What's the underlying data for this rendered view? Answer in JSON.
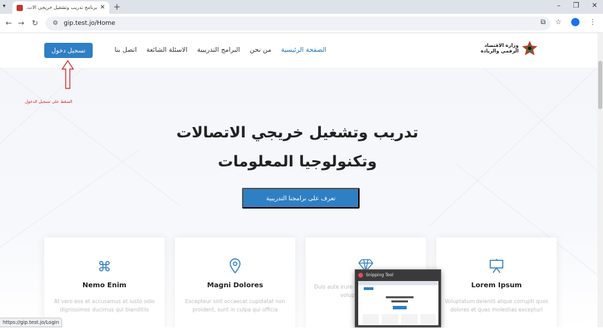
{
  "browser": {
    "tab_title": "برنامج تدريب وتشغيل خريجي الات...",
    "url": "gip.test.jo/Home",
    "status_url": "https://gip.test.jo/Login"
  },
  "site": {
    "logo_line1": "وزارة الاقتصاد",
    "logo_line2": "الرقمي والريادة",
    "nav": [
      "الصفحة الرئيسية",
      "من نحن",
      "البرامج التدريبية",
      "الاسئلة الشائعة",
      "اتصل بنا"
    ],
    "login_label": "تسجيل دخول",
    "annotation": "الضغط على تسجيل الدخول",
    "hero_title": "تدريب وتشغيل خريجي الاتصالات وتكنولوجيا المعلومات",
    "cta_label": "تعرف على برامجنا التدريبية",
    "cards": [
      {
        "icon": "command-icon",
        "title": "Nemo Enim",
        "desc": "At vero eos et accusamus et iusto odio dignissimos ducimus qui blanditiis"
      },
      {
        "icon": "location-pin-icon",
        "title": "Magni Dolores",
        "desc": "Excepteur sint occaecat cupidatat non proident, sunt in culpa qui officia"
      },
      {
        "icon": "diamond-icon",
        "title": "",
        "desc": "Duis aute irure dolor in reprehenderit in voluptate velit esse"
      },
      {
        "icon": "easel-icon",
        "title": "Lorem Ipsum",
        "desc": "Voluptatum deleniti atque corrupti quos dolores et quas molestias excepturi"
      }
    ]
  },
  "snipping_tool": {
    "title": "Snipping Tool"
  },
  "colors": {
    "primary": "#2f7fc4",
    "annotation": "#d21f1f"
  }
}
